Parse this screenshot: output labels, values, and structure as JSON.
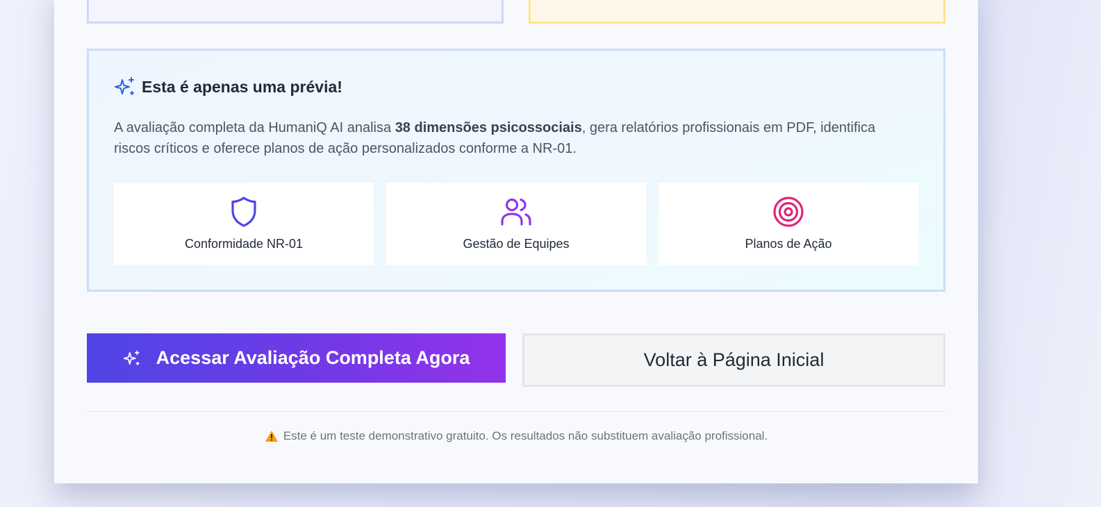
{
  "preview": {
    "title": "Esta é apenas uma prévia!",
    "text_before": "A avaliação completa da HumaniQ AI analisa ",
    "text_bold": "38 dimensões psicossociais",
    "text_after": ", gera relatórios profissionais em PDF, identifica riscos críticos e oferece planos de ação personalizados conforme a NR-01.",
    "icon": "sparkles-icon"
  },
  "features": [
    {
      "label": "Conformidade NR-01",
      "icon": "shield-icon",
      "color": "#4f46e5"
    },
    {
      "label": "Gestão de Equipes",
      "icon": "users-icon",
      "color": "#9333ea"
    },
    {
      "label": "Planos de Ação",
      "icon": "target-icon",
      "color": "#db2777"
    }
  ],
  "actions": {
    "primary_label": "Acessar Avaliação Completa Agora",
    "secondary_label": "Voltar à Página Inicial"
  },
  "disclaimer": {
    "text": "Este é um teste demonstrativo gratuito. Os resultados não substituem avaliação profissional.",
    "icon": "warning-icon"
  },
  "colors": {
    "accent_start": "#4f46e5",
    "accent_end": "#9333ea",
    "sparkle_blue": "#2563eb"
  }
}
